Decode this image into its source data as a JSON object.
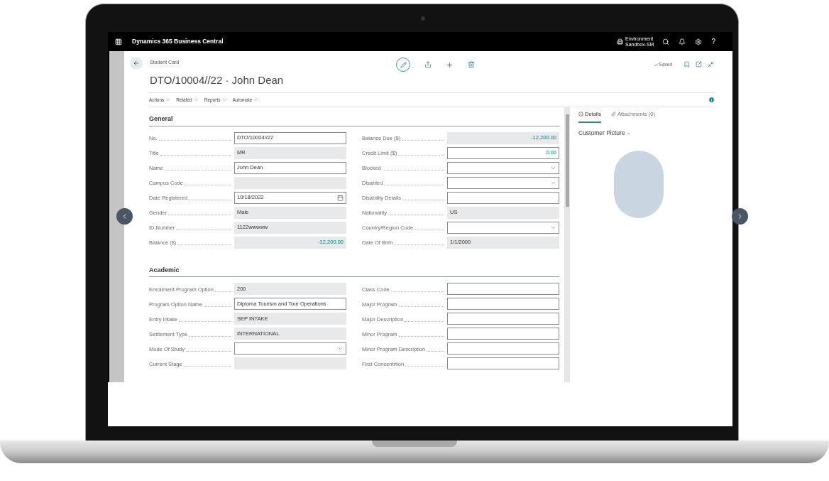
{
  "app": {
    "title": "Dynamics 365 Business Central",
    "environment_label": "Environment",
    "environment_name": "Sandbox-SM",
    "help": "?"
  },
  "page": {
    "caption": "Student Card",
    "title": "DTO/10004//22 · John Dean",
    "save_status": "Saved"
  },
  "action_menus": [
    "Actions",
    "Related",
    "Reports",
    "Automate"
  ],
  "sections": [
    {
      "title": "General",
      "left_fields": [
        {
          "label": "No.",
          "kind": "text",
          "value": "DTO/10004//22"
        },
        {
          "label": "Title",
          "kind": "readonly",
          "value": "MR"
        },
        {
          "label": "Name",
          "kind": "text",
          "value": "John Dean"
        },
        {
          "label": "Campus Code",
          "kind": "readonly"
        },
        {
          "label": "Date Registered",
          "kind": "date",
          "value": "10/18/2022"
        },
        {
          "label": "Gender",
          "kind": "readonly",
          "value": "Male"
        },
        {
          "label": "ID Number",
          "kind": "readonly",
          "value": "1122wwwww"
        },
        {
          "label": "Balance ($)",
          "kind": "readonly",
          "value": "-12,200.00",
          "numeric": true
        }
      ],
      "right_fields": [
        {
          "label": "Balance Due ($)",
          "kind": "readonly",
          "value": "-12,200.00",
          "numeric": true
        },
        {
          "label": "Credit Limit ($)",
          "kind": "text",
          "value": "0.00",
          "numeric": true
        },
        {
          "label": "Blocked",
          "kind": "select"
        },
        {
          "label": "Disabled",
          "kind": "select"
        },
        {
          "label": "Disability Details",
          "kind": "text"
        },
        {
          "label": "Nationality",
          "kind": "readonly",
          "value": "US"
        },
        {
          "label": "Country/Region Code",
          "kind": "select"
        },
        {
          "label": "Date Of Birth",
          "kind": "readonly",
          "value": "1/1/2000"
        }
      ]
    },
    {
      "title": "Academic",
      "left_fields": [
        {
          "label": "Enrollment Program Option",
          "kind": "readonly",
          "value": "200"
        },
        {
          "label": "Program Option Name",
          "kind": "text",
          "value": "Diploma Tourism and Tour Operations"
        },
        {
          "label": "Entry Intake",
          "kind": "readonly",
          "value": "SEP INTAKE"
        },
        {
          "label": "Settlement Type",
          "kind": "readonly",
          "value": "INTERNATIONAL"
        },
        {
          "label": "Mode Of Study",
          "kind": "select"
        },
        {
          "label": "Current Stage",
          "kind": "readonly"
        }
      ],
      "right_fields": [
        {
          "label": "Class Code",
          "kind": "text"
        },
        {
          "label": "Major Program",
          "kind": "text"
        },
        {
          "label": "Major Description",
          "kind": "text"
        },
        {
          "label": "Minor Program",
          "kind": "text"
        },
        {
          "label": "Minor Program Description",
          "kind": "text"
        },
        {
          "label": "First Concentrtion",
          "kind": "text"
        }
      ]
    }
  ],
  "factbox": {
    "tabs": [
      {
        "label": "Details",
        "selected": true
      },
      {
        "label": "Attachments (0)",
        "selected": false
      }
    ],
    "part_title": "Customer Picture"
  }
}
